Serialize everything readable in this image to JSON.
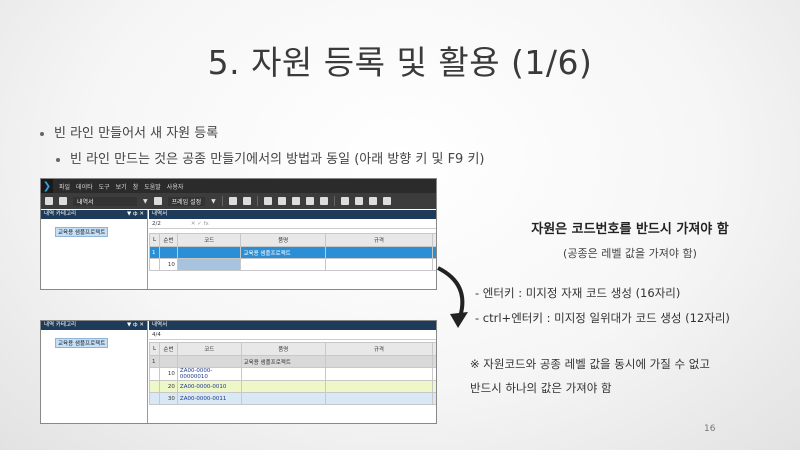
{
  "slide": {
    "title": "5. 자원 등록 및 활용 (1/6)",
    "bullet1": "빈 라인 만들어서 새 자원 등록",
    "bullet2": "빈 라인 만드는 것은 공종 만들기에서의 방법과 동일 (아래 방향 키 및 F9 키)",
    "page_number": "16"
  },
  "app1": {
    "menu": [
      "파일",
      "데이타",
      "도구",
      "보기",
      "창",
      "도움말",
      "사용자"
    ],
    "toolbar": {
      "view_select": "내역서",
      "frame_select": "프레임 설정"
    },
    "left_panel": {
      "title": "내역 카테고리",
      "pin": "▼ ф ✕",
      "tree_item": "교육용 샘플프로젝트"
    },
    "right_panel": {
      "title": "내역서",
      "page": "2/2",
      "columns": [
        "L",
        "순번",
        "코드",
        "품명",
        "규격"
      ],
      "rows": [
        {
          "l": "1",
          "seq": "",
          "code": "",
          "name": "교육용 샘플프로젝트",
          "spec": ""
        },
        {
          "l": "",
          "seq": "10",
          "code": "",
          "name": "",
          "spec": ""
        }
      ]
    }
  },
  "app2": {
    "left_panel": {
      "title": "내역 카테고리",
      "pin": "▼ ф ✕",
      "tree_item": "교육용 샘플프로젝트"
    },
    "right_panel": {
      "title": "내역서",
      "page": "4/4",
      "columns": [
        "L",
        "순번",
        "코드",
        "품명",
        "규격"
      ],
      "rows": [
        {
          "l": "1",
          "seq": "",
          "code": "",
          "name": "교육용 샘플프로젝트",
          "spec": ""
        },
        {
          "l": "",
          "seq": "10",
          "code": "ZA00-0000-00000010",
          "name": "",
          "spec": ""
        },
        {
          "l": "",
          "seq": "20",
          "code": "ZA00-0000-0010",
          "name": "",
          "spec": ""
        },
        {
          "l": "",
          "seq": "30",
          "code": "ZA00-0000-0011",
          "name": "",
          "spec": ""
        }
      ]
    }
  },
  "right_text": {
    "title": "자원은 코드번호를 반드시 가져야 함",
    "subtitle": "(공종은 레벨 값을 가져야 함)",
    "item1": "- 엔터키 : 미지정 자재 코드 생성 (16자리)",
    "item2": "- ctrl+엔터키 : 미지정 일위대가 코드 생성 (12자리)",
    "note1": "※ 자원코드와 공종 레벨 값을 동시에 가질 수 없고",
    "note2": "반드시 하나의 값은 가져야 함"
  },
  "colors": {
    "panel_header": "#1e3c5a",
    "selected_row": "#2b8fd6",
    "row_green": "#eef7c8",
    "row_blue": "#d9e8f5"
  }
}
